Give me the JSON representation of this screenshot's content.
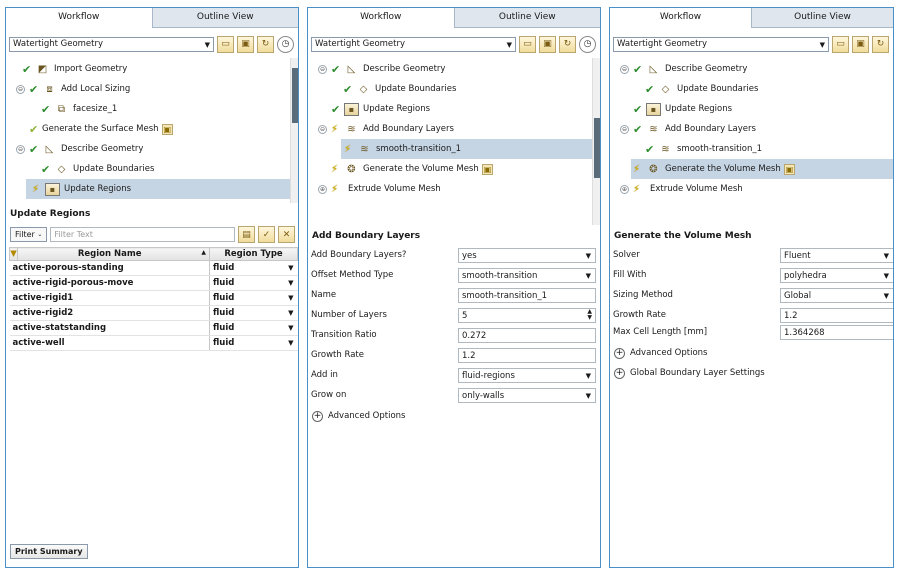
{
  "tabs": {
    "workflow": "Workflow",
    "outline": "Outline View"
  },
  "workflow_type": "Watertight Geometry",
  "panel1": {
    "tree": [
      {
        "label": "Import Geometry",
        "status": "check",
        "expander": "",
        "icon": "import-geometry-icon"
      },
      {
        "label": "Add Local Sizing",
        "status": "check",
        "expander": "⊖",
        "icon": "local-sizing-icon"
      },
      {
        "label": "facesize_1",
        "status": "check",
        "expander": "",
        "icon": "face-size-icon"
      },
      {
        "label": "Generate the Surface Mesh",
        "status": "pending",
        "expander": "",
        "icon": "surface-mesh-icon"
      },
      {
        "label": "Describe Geometry",
        "status": "check",
        "expander": "⊖",
        "icon": "describe-geometry-icon"
      },
      {
        "label": "Update Boundaries",
        "status": "check",
        "expander": "",
        "icon": "update-boundaries-icon"
      },
      {
        "label": "Update Regions",
        "status": "bolt",
        "expander": "",
        "icon": "update-regions-icon"
      }
    ],
    "section_title": "Update Regions",
    "filter_label": "Filter",
    "filter_placeholder": "Filter Text",
    "columns": {
      "name": "Region Name",
      "type": "Region Type"
    },
    "rows": [
      {
        "name": "active-porous-standing",
        "type": "fluid"
      },
      {
        "name": "active-rigid-porous-move",
        "type": "fluid"
      },
      {
        "name": "active-rigid1",
        "type": "fluid"
      },
      {
        "name": "active-rigid2",
        "type": "fluid"
      },
      {
        "name": "active-statstanding",
        "type": "fluid"
      },
      {
        "name": "active-well",
        "type": "fluid"
      }
    ],
    "print_summary": "Print Summary"
  },
  "panel2": {
    "tree": [
      {
        "label": "Describe Geometry",
        "status": "check",
        "expander": "⊖",
        "icon": "describe-geometry-icon"
      },
      {
        "label": "Update Boundaries",
        "status": "check",
        "expander": "",
        "icon": "update-boundaries-icon"
      },
      {
        "label": "Update Regions",
        "status": "check",
        "expander": "",
        "icon": "update-regions-icon"
      },
      {
        "label": "Add Boundary Layers",
        "status": "bolt",
        "expander": "⊖",
        "icon": "boundary-layers-icon"
      },
      {
        "label": "smooth-transition_1",
        "status": "bolt",
        "expander": "",
        "icon": "smooth-transition-icon"
      },
      {
        "label": "Generate the Volume Mesh",
        "status": "bolt",
        "expander": "",
        "icon": "volume-mesh-icon"
      },
      {
        "label": "Extrude Volume Mesh",
        "status": "bolt",
        "expander": "⊕",
        "icon": "extrude-mesh-icon"
      }
    ],
    "section_title": "Add Boundary Layers",
    "fields": [
      {
        "label": "Add Boundary Layers?",
        "value": "yes",
        "control": "dropdown"
      },
      {
        "label": "Offset Method Type",
        "value": "smooth-transition",
        "control": "dropdown"
      },
      {
        "label": "Name",
        "value": "smooth-transition_1",
        "control": "text"
      },
      {
        "label": "Number of Layers",
        "value": "5",
        "control": "spinner"
      },
      {
        "label": "Transition Ratio",
        "value": "0.272",
        "control": "text"
      },
      {
        "label": "Growth Rate",
        "value": "1.2",
        "control": "text"
      },
      {
        "label": "Add in",
        "value": "fluid-regions",
        "control": "dropdown"
      },
      {
        "label": "Grow on",
        "value": "only-walls",
        "control": "dropdown"
      }
    ],
    "advanced": "Advanced Options"
  },
  "panel3": {
    "tree": [
      {
        "label": "Describe Geometry",
        "status": "check",
        "expander": "⊖",
        "icon": "describe-geometry-icon"
      },
      {
        "label": "Update Boundaries",
        "status": "check",
        "expander": "",
        "icon": "update-boundaries-icon"
      },
      {
        "label": "Update Regions",
        "status": "check",
        "expander": "",
        "icon": "update-regions-icon"
      },
      {
        "label": "Add Boundary Layers",
        "status": "check",
        "expander": "⊖",
        "icon": "boundary-layers-icon"
      },
      {
        "label": "smooth-transition_1",
        "status": "check",
        "expander": "",
        "icon": "smooth-transition-icon"
      },
      {
        "label": "Generate the Volume Mesh",
        "status": "bolt",
        "expander": "",
        "icon": "volume-mesh-icon"
      },
      {
        "label": "Extrude Volume Mesh",
        "status": "bolt",
        "expander": "⊕",
        "icon": "extrude-mesh-icon"
      }
    ],
    "section_title": "Generate the Volume Mesh",
    "fields": [
      {
        "label": "Solver",
        "value": "Fluent",
        "control": "dropdown"
      },
      {
        "label": "Fill With",
        "value": "polyhedra",
        "control": "dropdown"
      },
      {
        "label": "Sizing Method",
        "value": "Global",
        "control": "dropdown"
      },
      {
        "label": "Growth Rate",
        "value": "1.2",
        "control": "text"
      },
      {
        "label": "Max Cell Length [mm]",
        "value": "1.364268",
        "control": "text"
      }
    ],
    "advanced": "Advanced Options",
    "global_bl": "Global Boundary Layer Settings"
  },
  "colors": {
    "panel_border": "#4a90c8",
    "selection": "#c6d5e4",
    "check": "#2e8b2e",
    "pending": "#d8b400"
  }
}
